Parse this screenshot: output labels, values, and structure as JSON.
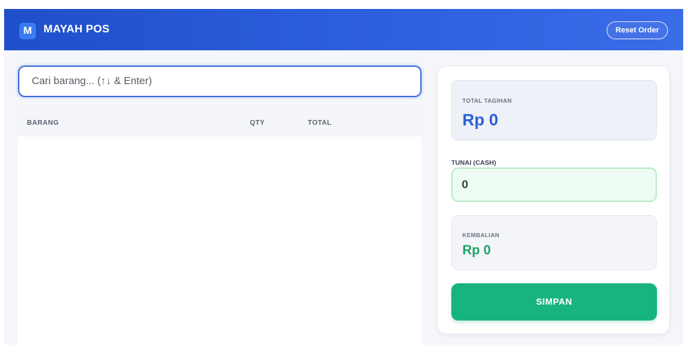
{
  "header": {
    "brand_letter": "M",
    "brand_name": "MAYAH POS",
    "reset_label": "Reset Order"
  },
  "search": {
    "placeholder": "Cari barang... (↑↓ & Enter)"
  },
  "table": {
    "columns": [
      "BARANG",
      "QTY",
      "TOTAL"
    ],
    "rows": []
  },
  "summary": {
    "total_label": "TOTAL TAGIHAN",
    "total_value": "Rp 0",
    "cash_label": "TUNAI (CASH)",
    "cash_value": "0",
    "change_label": "KEMBALIAN",
    "change_value": "Rp 0",
    "save_label": "SIMPAN"
  },
  "colors": {
    "header_blue": "#2a5bd7",
    "total_blue": "#2c5fd6",
    "success_green": "#18b47d"
  }
}
